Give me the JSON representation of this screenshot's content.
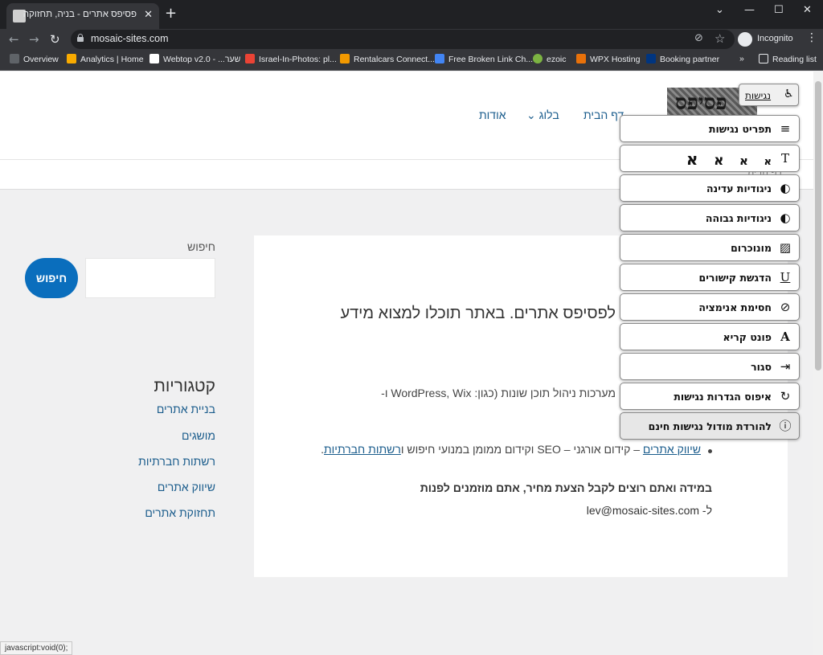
{
  "browser": {
    "tab_title": "פסיפס אתרים - בניה, תחזוקה וש...",
    "url": "mosaic-sites.com",
    "incognito_label": "Incognito",
    "bookmarks": [
      {
        "label": "Overview",
        "color": "#5f6368"
      },
      {
        "label": "Analytics | Home",
        "color": "#f9ab00"
      },
      {
        "label": "Webtop v2.0 - ...שער",
        "color": "#ffffff"
      },
      {
        "label": "Israel-In-Photos: pl...",
        "color": "#ea4335"
      },
      {
        "label": "Rentalcars Connect...",
        "color": "#f29900"
      },
      {
        "label": "Free Broken Link Ch...",
        "color": "#4285f4"
      },
      {
        "label": "ezoic",
        "color": "#7cb342"
      },
      {
        "label": "WPX Hosting",
        "color": "#e8710a"
      },
      {
        "label": "Booking partner",
        "color": "#003580"
      }
    ],
    "bookmarks_more": "»",
    "reading_list": "Reading list",
    "status_text": "javascript:void(0);"
  },
  "site": {
    "logo_text": "פסיפס",
    "nav": [
      "דף הבית",
      "בלוג",
      "אודות"
    ],
    "breadcrumb": "דף הבית"
  },
  "content": {
    "intro": "לפסיפס אתרים. באתר תוכלו למצוא מידע",
    "cms_line": "מערכות ניהול תוכן שונות (כגון: WordPress, Wix ו-",
    "bullet_link1": "שיווק אתרים",
    "bullet_text": " – קידום אורגני – SEO וקידום ממומן במנועי חיפוש ו",
    "bullet_link2": "רשתות חברתיות",
    "bullet_end": ".",
    "cta": "במידה ואתם רוצים לקבל הצעת מחיר, אתם מוזמנים לפנות",
    "email": "ל- lev@mosaic-sites.com"
  },
  "sidebar": {
    "search_label": "חיפוש",
    "search_button": "חיפוש",
    "categories_title": "קטגוריות",
    "categories": [
      "בניית אתרים",
      "מושגים",
      "רשתות חברתיות",
      "שיווק אתרים",
      "תחזוקת אתרים"
    ]
  },
  "accessibility": {
    "toggle_label": "נגישות",
    "font_sizes": [
      "א",
      "א",
      "א",
      "א"
    ],
    "items": [
      {
        "label": "תפריט נגישות",
        "icon": "menu-icon"
      },
      {
        "label": "ניגודיות עדינה",
        "icon": "contrast-icon"
      },
      {
        "label": "ניגודיות גבוהה",
        "icon": "contrast-icon"
      },
      {
        "label": "מונוכרום",
        "icon": "image-icon"
      },
      {
        "label": "הדגשת קישורים",
        "icon": "underline-icon"
      },
      {
        "label": "חסימת אנימציה",
        "icon": "eye-slash-icon"
      },
      {
        "label": "פונט קריא",
        "icon": "font-icon"
      },
      {
        "label": "סגור",
        "icon": "exit-icon"
      },
      {
        "label": "איפוס הגדרות נגישות",
        "icon": "reset-icon"
      },
      {
        "label": "להורדת מודול נגישות חינם",
        "icon": "info-icon"
      }
    ]
  }
}
